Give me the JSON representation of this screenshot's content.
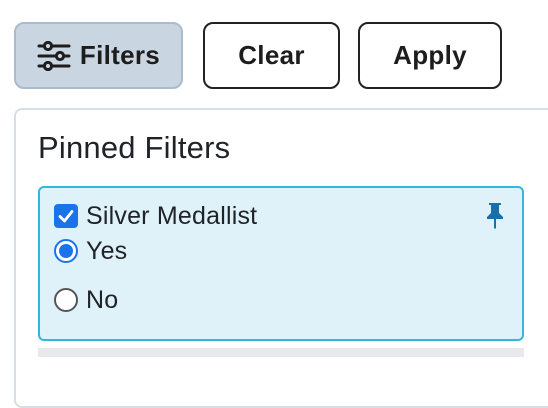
{
  "toolbar": {
    "filters_label": "Filters",
    "clear_label": "Clear",
    "apply_label": "Apply",
    "filters_icon": "sliders-icon"
  },
  "pinned_filters": {
    "title": "Pinned Filters",
    "filter": {
      "label": "Silver Medallist",
      "checked": true,
      "pin_icon": "pin-icon",
      "options": [
        {
          "label": "Yes",
          "selected": true
        },
        {
          "label": "No",
          "selected": false
        }
      ]
    }
  },
  "colors": {
    "accent": "#1a73e8",
    "card_border": "#36b6d8",
    "card_bg": "#dff1f9",
    "filters_button_bg": "#c9d6e2"
  }
}
